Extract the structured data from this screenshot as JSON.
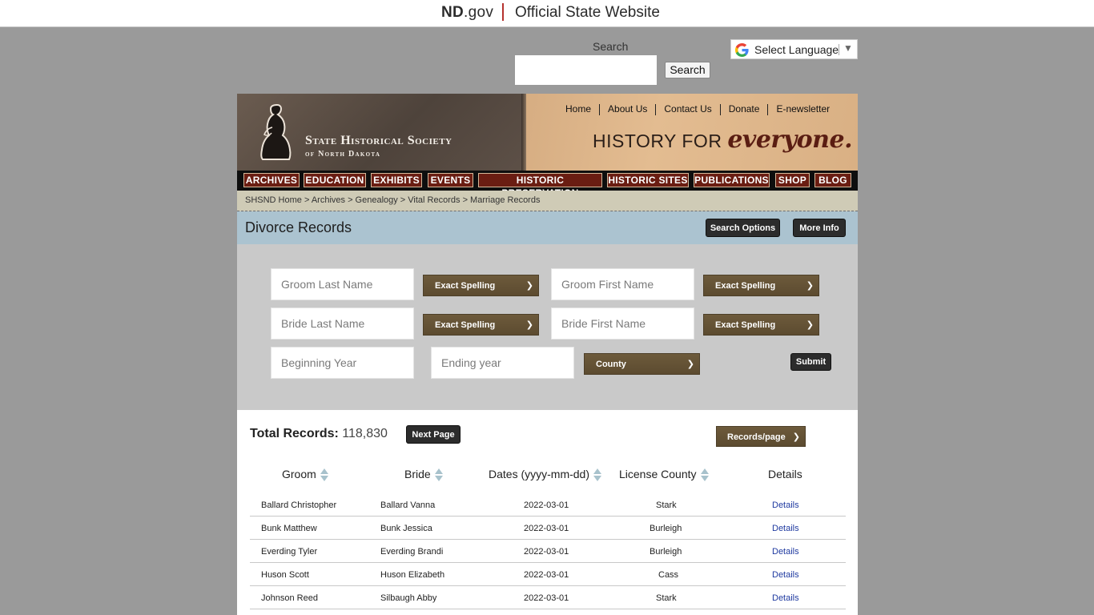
{
  "state_bar": {
    "nd_bold": "ND",
    "nd_rest": ".gov",
    "official": "Official State Website"
  },
  "search": {
    "label": "Search",
    "placeholder": "",
    "button": "Search"
  },
  "language": {
    "label": "Select Language",
    "caret": "▼"
  },
  "header": {
    "logo_line1": "State Historical Society",
    "logo_line2": "of North Dakota",
    "top_nav": [
      "Home",
      "About Us",
      "Contact Us",
      "Donate",
      "E-newsletter"
    ],
    "tagline_plain": "HISTORY FOR ",
    "tagline_script": "everyone."
  },
  "menu": [
    "ARCHIVES",
    "EDUCATION",
    "EXHIBITS",
    "EVENTS",
    "HISTORIC PRESERVATION",
    "HISTORIC SITES",
    "PUBLICATIONS",
    "SHOP",
    "BLOG"
  ],
  "breadcrumb": "SHSND Home > Archives > Genealogy > Vital Records > Marriage Records",
  "page": {
    "title": "Divorce Records",
    "search_options": "Search Options",
    "more_info": "More Info"
  },
  "form": {
    "groom_last": "Groom Last Name",
    "groom_first": "Groom First Name",
    "bride_last": "Bride Last Name",
    "bride_first": "Bride First Name",
    "begin_year": "Beginning Year",
    "end_year": "Ending year",
    "spelling": "Exact Spelling",
    "county": "County",
    "submit": "Submit"
  },
  "results": {
    "total_label": "Total Records:",
    "total_value": "118,830",
    "next_page": "Next Page",
    "records_per_page": "Records/page",
    "columns": [
      "Groom",
      "Bride",
      "Dates (yyyy-mm-dd)",
      "License County",
      "Details"
    ],
    "rows": [
      {
        "groom": "Ballard Christopher",
        "bride": "Ballard Vanna",
        "date": "2022-03-01",
        "county": "Stark",
        "details": "Details"
      },
      {
        "groom": "Bunk Matthew",
        "bride": "Bunk Jessica",
        "date": "2022-03-01",
        "county": "Burleigh",
        "details": "Details"
      },
      {
        "groom": "Everding Tyler",
        "bride": "Everding Brandi",
        "date": "2022-03-01",
        "county": "Burleigh",
        "details": "Details"
      },
      {
        "groom": "Huson Scott",
        "bride": "Huson Elizabeth",
        "date": "2022-03-01",
        "county": "Cass",
        "details": "Details"
      },
      {
        "groom": "Johnson Reed",
        "bride": "Silbaugh Abby",
        "date": "2022-03-01",
        "county": "Stark",
        "details": "Details"
      }
    ]
  },
  "colors": {
    "menu_item": "#6a1d12",
    "select_brown": "#6d5a3b",
    "title_bar": "#abc3d0",
    "link": "#1f3aa0"
  }
}
